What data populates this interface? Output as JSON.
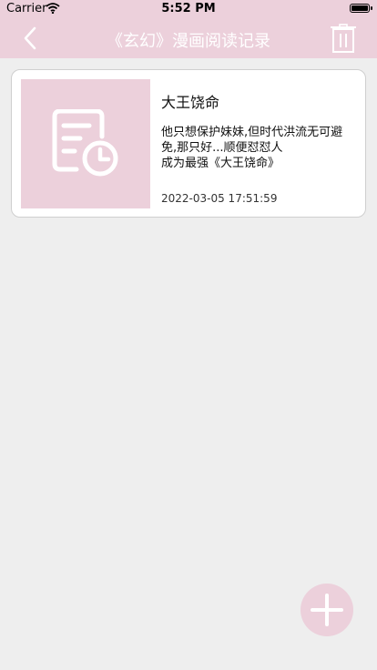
{
  "status_bar": {
    "carrier": "Carrier",
    "time": "5:52 PM"
  },
  "header": {
    "title": "《玄幻》漫画阅读记录"
  },
  "records": [
    {
      "title": "大王饶命",
      "description": "他只想保护妹妹,但时代洪流无可避免,那只好...顺便怼怼人\n成为最强《大王饶命》",
      "timestamp": "2022-03-05 17:51:59"
    }
  ],
  "colors": {
    "accent": "#ecd0db",
    "background": "#eeeeee",
    "card": "#ffffff"
  },
  "icons": {
    "back": "chevron-left-icon",
    "delete": "trash-icon",
    "thumbnail": "document-clock-icon",
    "add": "plus-icon"
  }
}
